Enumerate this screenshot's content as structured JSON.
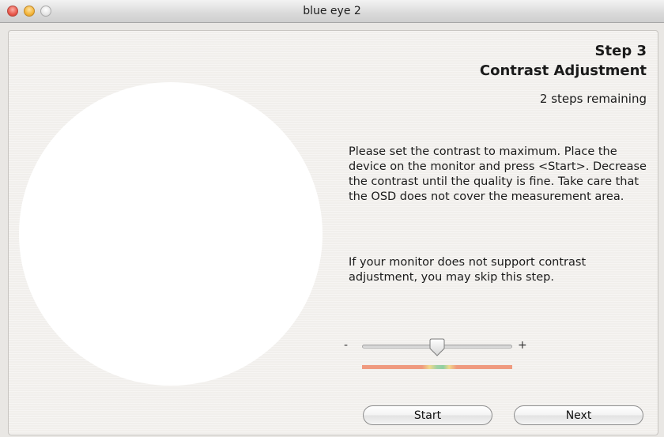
{
  "window": {
    "title": "blue eye 2"
  },
  "step": {
    "number_label": "Step 3",
    "name": "Contrast Adjustment",
    "remaining": "2 steps remaining"
  },
  "instructions": "Please set the contrast to maximum. Place the device on the monitor and press <Start>. Decrease the contrast until the quality is fine. Take care that the OSD does not cover the measurement area.",
  "skip_note": "If your monitor does not support contrast adjustment, you may skip this step.",
  "slider": {
    "min_label": "-",
    "max_label": "+",
    "value_fraction": 0.5
  },
  "buttons": {
    "start": "Start",
    "next": "Next"
  },
  "colors": {
    "quality_bad": "#ef9a7f",
    "quality_fair": "#f1d98c",
    "quality_good": "#8fd0a2"
  }
}
